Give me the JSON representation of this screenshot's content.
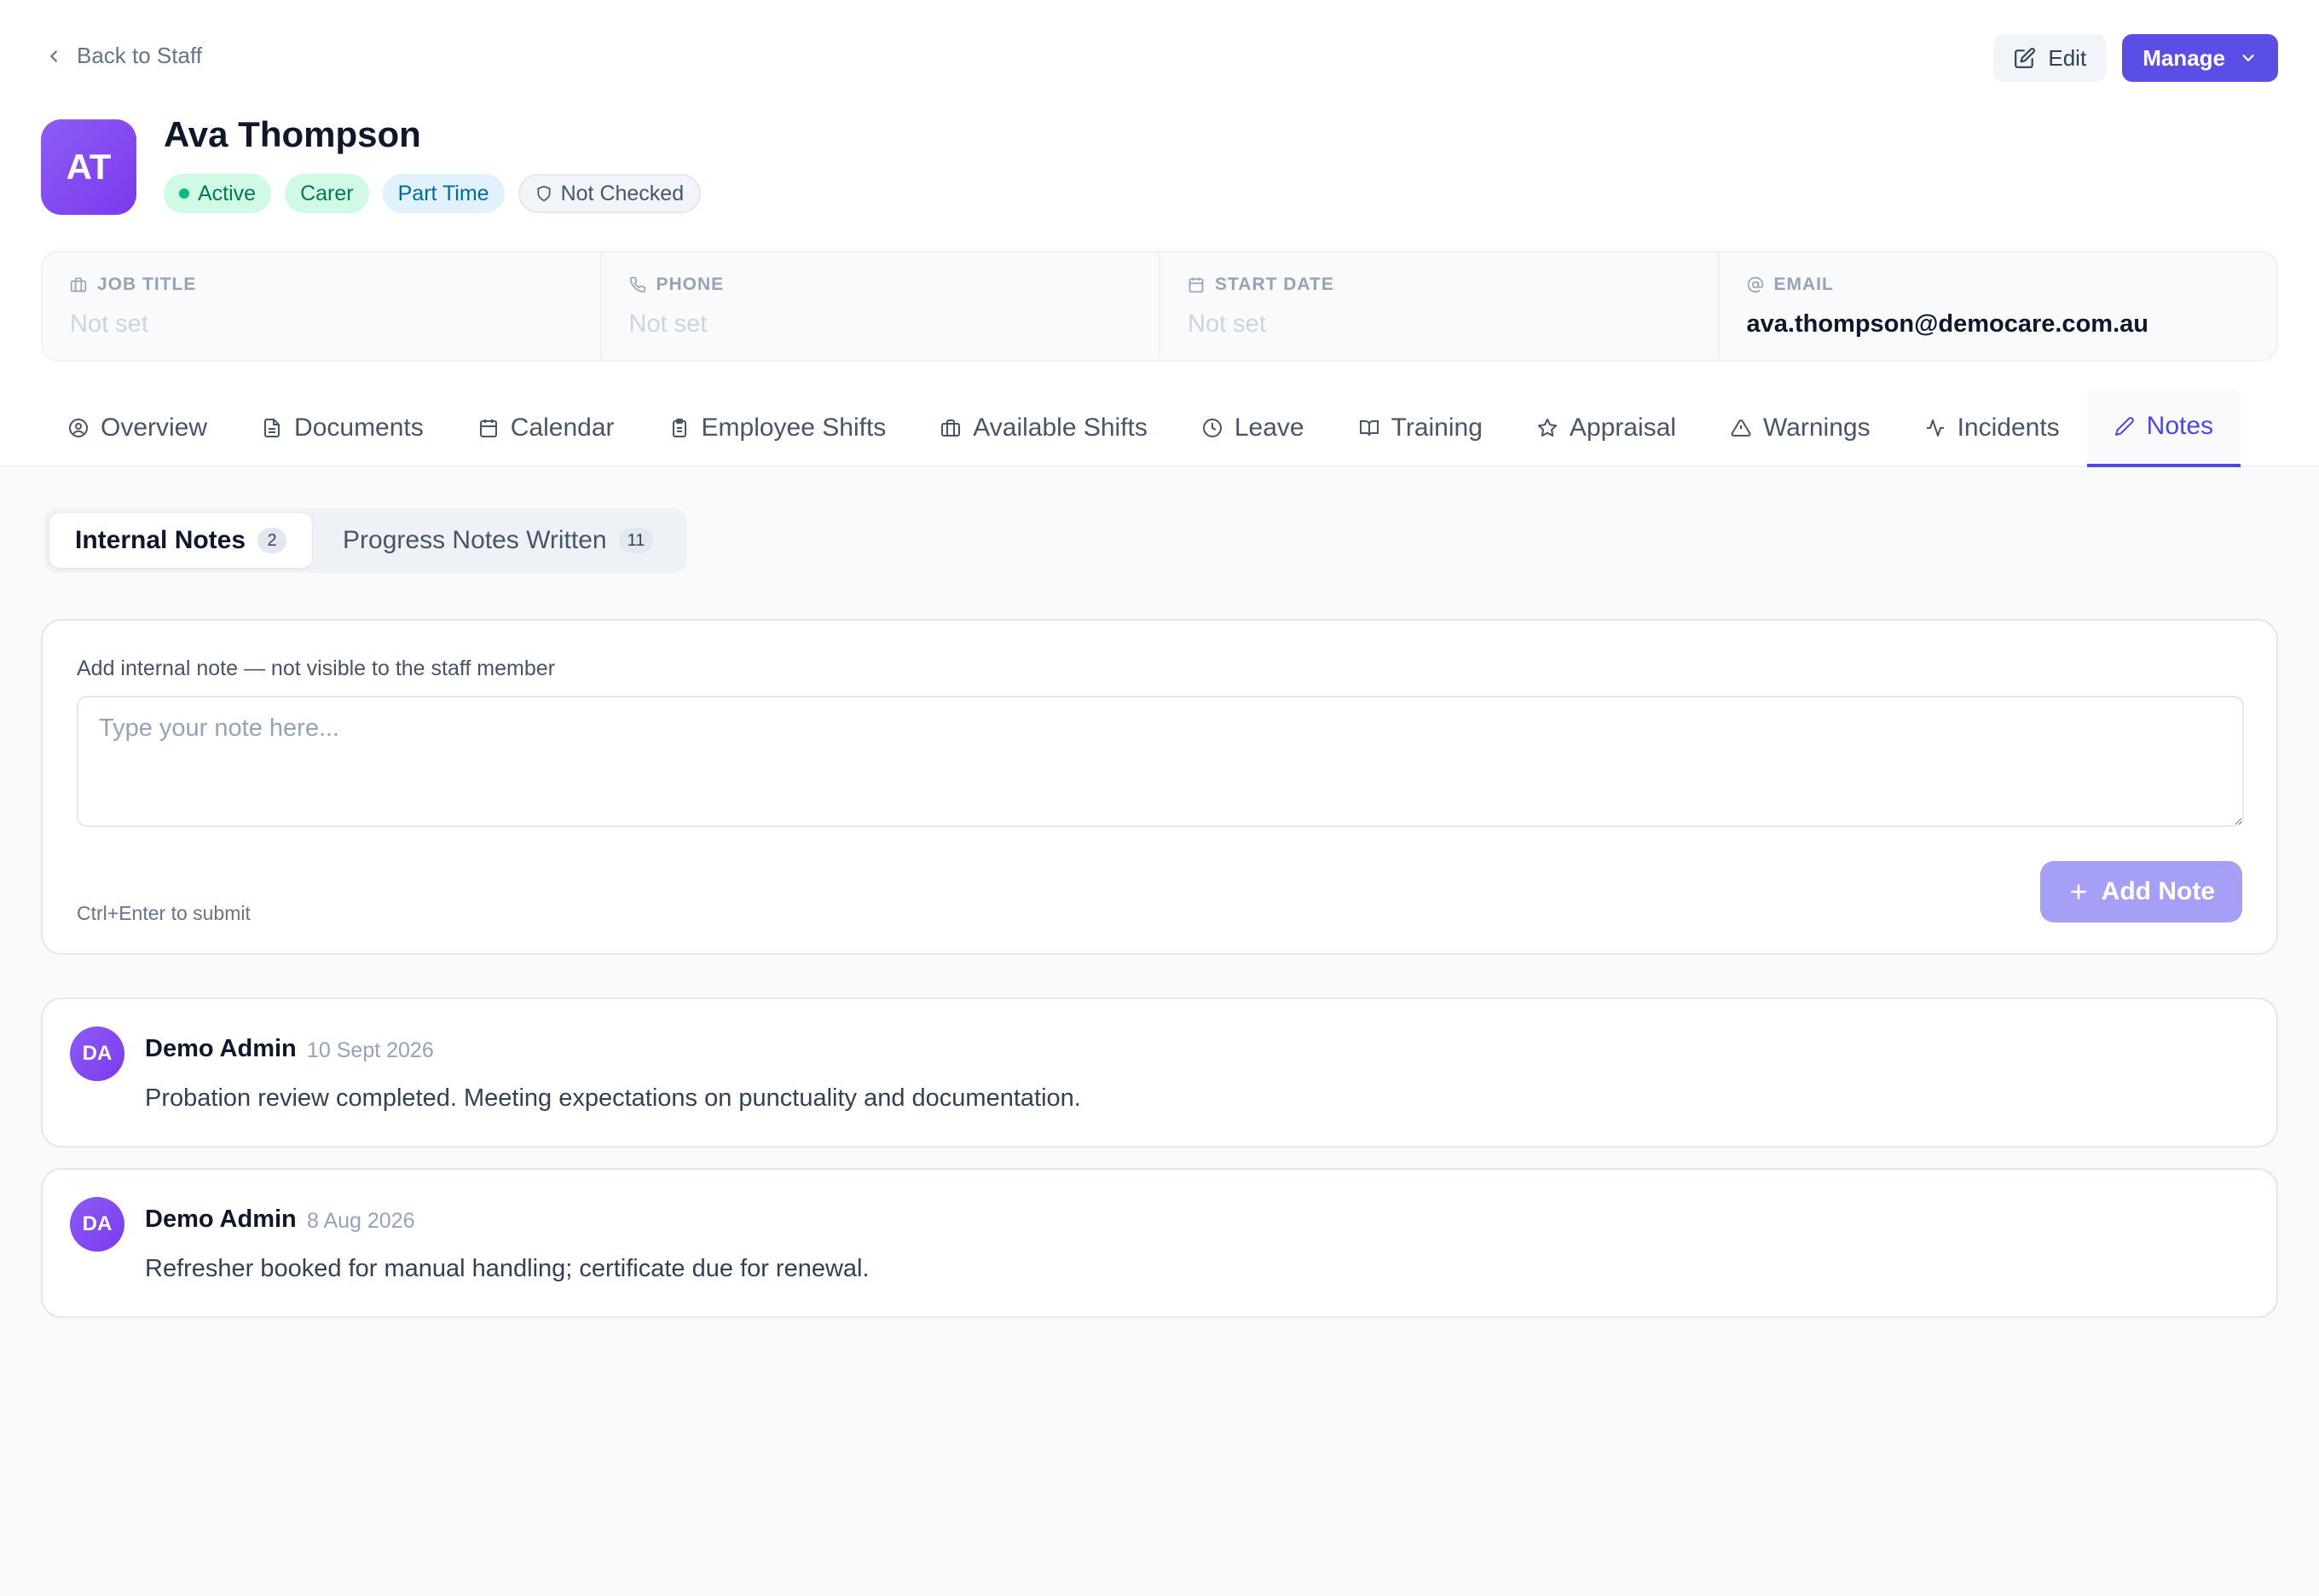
{
  "nav": {
    "back_label": "Back to Staff"
  },
  "actions": {
    "edit_label": "Edit",
    "manage_label": "Manage"
  },
  "profile": {
    "initials": "AT",
    "name": "Ava Thompson",
    "badges": {
      "status": "Active",
      "role": "Carer",
      "employment": "Part Time",
      "check": "Not Checked"
    }
  },
  "info": {
    "job_title": {
      "label": "JOB TITLE",
      "value": "Not set"
    },
    "phone": {
      "label": "PHONE",
      "value": "Not set"
    },
    "start_date": {
      "label": "START DATE",
      "value": "Not set"
    },
    "email": {
      "label": "EMAIL",
      "value": "ava.thompson@democare.com.au"
    }
  },
  "tabs": [
    {
      "label": "Overview",
      "icon": "user-circle-icon"
    },
    {
      "label": "Documents",
      "icon": "document-icon"
    },
    {
      "label": "Calendar",
      "icon": "calendar-icon"
    },
    {
      "label": "Employee Shifts",
      "icon": "clipboard-icon"
    },
    {
      "label": "Available Shifts",
      "icon": "briefcase-icon"
    },
    {
      "label": "Leave",
      "icon": "clock-icon"
    },
    {
      "label": "Training",
      "icon": "book-icon"
    },
    {
      "label": "Appraisal",
      "icon": "star-icon"
    },
    {
      "label": "Warnings",
      "icon": "warning-icon"
    },
    {
      "label": "Incidents",
      "icon": "activity-icon"
    },
    {
      "label": "Notes",
      "icon": "pencil-icon",
      "active": true
    }
  ],
  "subtabs": {
    "internal": {
      "label": "Internal Notes",
      "count": "2"
    },
    "progress": {
      "label": "Progress Notes Written",
      "count": "11"
    }
  },
  "composer": {
    "label": "Add internal note — not visible to the staff member",
    "placeholder": "Type your note here...",
    "hint": "Ctrl+Enter to submit",
    "submit_label": "Add Note"
  },
  "notes": [
    {
      "initials": "DA",
      "author": "Demo Admin",
      "date": "10 Sept 2026",
      "body": "Probation review completed. Meeting expectations on punctuality and documentation."
    },
    {
      "initials": "DA",
      "author": "Demo Admin",
      "date": "8 Aug 2026",
      "body": "Refresher booked for manual handling; certificate due for renewal."
    }
  ],
  "colors": {
    "accent": "#4f46e5",
    "primary_button": "#5b4ee6",
    "avatar_gradient_start": "#8b5cf6",
    "avatar_gradient_end": "#7c3aed",
    "active_badge": "#d1fae5",
    "part_time_badge": "#e0f2fe"
  }
}
